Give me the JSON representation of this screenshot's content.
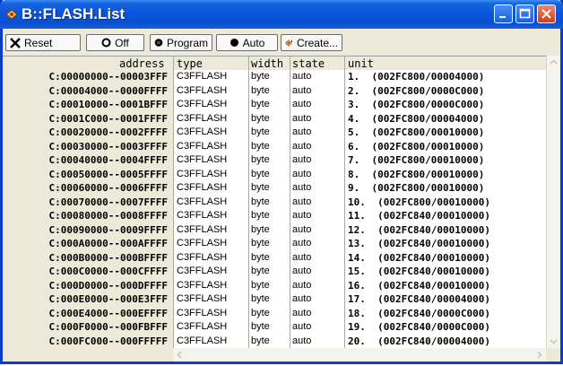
{
  "window": {
    "title": "B::FLASH.List"
  },
  "toolbar": {
    "reset": "Reset",
    "off": "Off",
    "program": "Program",
    "auto": "Auto",
    "create": "Create..."
  },
  "columns": {
    "address": "address",
    "type": "type",
    "width": "width",
    "state": "state",
    "unit": "unit"
  },
  "rows": [
    {
      "address": "C:00000000--00003FFF",
      "type": "C3FFLASH",
      "width": "byte",
      "state": "auto",
      "unit": "1.  (002FC800/00004000)"
    },
    {
      "address": "C:00004000--0000FFFF",
      "type": "C3FFLASH",
      "width": "byte",
      "state": "auto",
      "unit": "2.  (002FC800/0000C000)"
    },
    {
      "address": "C:00010000--0001BFFF",
      "type": "C3FFLASH",
      "width": "byte",
      "state": "auto",
      "unit": "3.  (002FC800/0000C000)"
    },
    {
      "address": "C:0001C000--0001FFFF",
      "type": "C3FFLASH",
      "width": "byte",
      "state": "auto",
      "unit": "4.  (002FC800/00004000)"
    },
    {
      "address": "C:00020000--0002FFFF",
      "type": "C3FFLASH",
      "width": "byte",
      "state": "auto",
      "unit": "5.  (002FC800/00010000)"
    },
    {
      "address": "C:00030000--0003FFFF",
      "type": "C3FFLASH",
      "width": "byte",
      "state": "auto",
      "unit": "6.  (002FC800/00010000)"
    },
    {
      "address": "C:00040000--0004FFFF",
      "type": "C3FFLASH",
      "width": "byte",
      "state": "auto",
      "unit": "7.  (002FC800/00010000)"
    },
    {
      "address": "C:00050000--0005FFFF",
      "type": "C3FFLASH",
      "width": "byte",
      "state": "auto",
      "unit": "8.  (002FC800/00010000)"
    },
    {
      "address": "C:00060000--0006FFFF",
      "type": "C3FFLASH",
      "width": "byte",
      "state": "auto",
      "unit": "9.  (002FC800/00010000)"
    },
    {
      "address": "C:00070000--0007FFFF",
      "type": "C3FFLASH",
      "width": "byte",
      "state": "auto",
      "unit": "10.  (002FC800/00010000)"
    },
    {
      "address": "C:00080000--0008FFFF",
      "type": "C3FFLASH",
      "width": "byte",
      "state": "auto",
      "unit": "11.  (002FC840/00010000)"
    },
    {
      "address": "C:00090000--0009FFFF",
      "type": "C3FFLASH",
      "width": "byte",
      "state": "auto",
      "unit": "12.  (002FC840/00010000)"
    },
    {
      "address": "C:000A0000--000AFFFF",
      "type": "C3FFLASH",
      "width": "byte",
      "state": "auto",
      "unit": "13.  (002FC840/00010000)"
    },
    {
      "address": "C:000B0000--000BFFFF",
      "type": "C3FFLASH",
      "width": "byte",
      "state": "auto",
      "unit": "14.  (002FC840/00010000)"
    },
    {
      "address": "C:000C0000--000CFFFF",
      "type": "C3FFLASH",
      "width": "byte",
      "state": "auto",
      "unit": "15.  (002FC840/00010000)"
    },
    {
      "address": "C:000D0000--000DFFFF",
      "type": "C3FFLASH",
      "width": "byte",
      "state": "auto",
      "unit": "16.  (002FC840/00010000)"
    },
    {
      "address": "C:000E0000--000E3FFF",
      "type": "C3FFLASH",
      "width": "byte",
      "state": "auto",
      "unit": "17.  (002FC840/00004000)"
    },
    {
      "address": "C:000E4000--000EFFFF",
      "type": "C3FFLASH",
      "width": "byte",
      "state": "auto",
      "unit": "18.  (002FC840/0000C000)"
    },
    {
      "address": "C:000F0000--000FBFFF",
      "type": "C3FFLASH",
      "width": "byte",
      "state": "auto",
      "unit": "19.  (002FC840/0000C000)"
    },
    {
      "address": "C:000FC000--000FFFFF",
      "type": "C3FFLASH",
      "width": "byte",
      "state": "auto",
      "unit": "20.  (002FC840/00004000)"
    }
  ],
  "icons": {
    "app": "trace32-icon",
    "reset": "x-mark-icon",
    "off": "hollow-circle-icon",
    "program": "filled-circle-icon",
    "auto": "filled-circle-icon",
    "create": "create-icon"
  },
  "colors": {
    "titlebar": "#0a4fd2",
    "close_button": "#c7401b",
    "panel": "#ece9d8"
  }
}
